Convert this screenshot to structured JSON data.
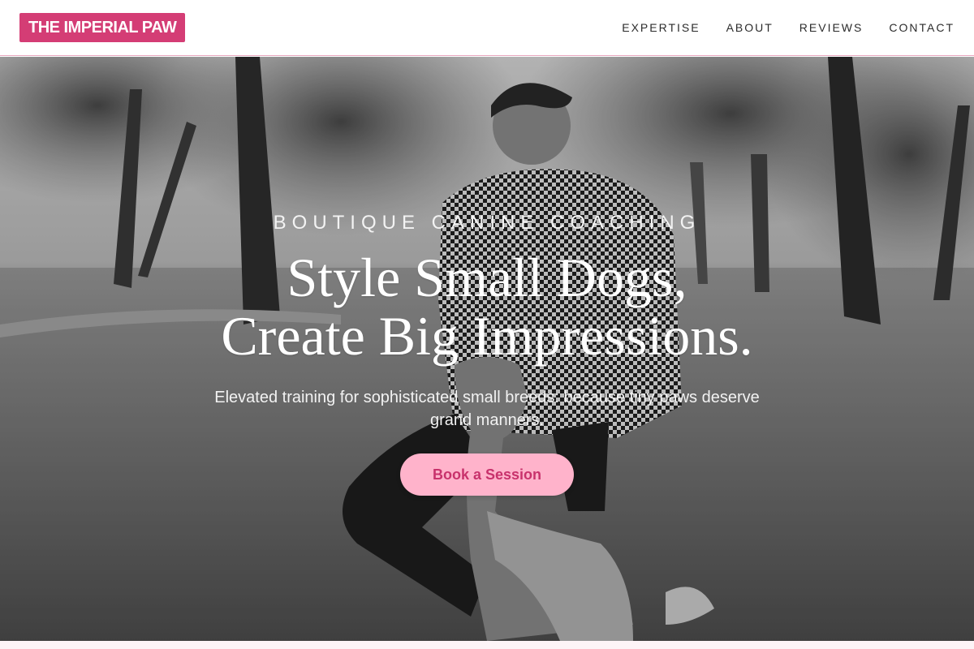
{
  "brand": {
    "name": "THE IMPERIAL PAW",
    "color": "#d43d75"
  },
  "nav": {
    "items": [
      {
        "label": "EXPERTISE"
      },
      {
        "label": "ABOUT"
      },
      {
        "label": "REVIEWS"
      },
      {
        "label": "CONTACT"
      }
    ]
  },
  "hero": {
    "eyebrow": "BOUTIQUE CANINE COACHING",
    "headline_line1": "Style Small Dogs,",
    "headline_line2": "Create Big Impressions.",
    "subhead": "Elevated training for sophisticated small breeds: because tiny paws deserve grand manners.",
    "cta_label": "Book a Session",
    "cta_bg": "#ffb3cb",
    "cta_text_color": "#c8326c",
    "image": "man-training-dog-in-park-photo"
  }
}
